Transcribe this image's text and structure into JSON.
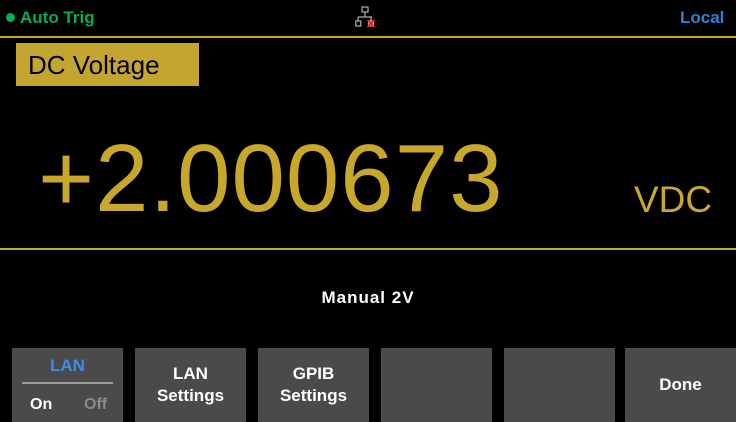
{
  "status_bar": {
    "trigger": "Auto  Trig",
    "remote": "Local",
    "network_icon": "lan-disconnected-icon",
    "indicator_color": "#00b050"
  },
  "measurement": {
    "function": "DC Voltage",
    "value": "+2.000673",
    "unit": "VDC",
    "range": "Manual  2V"
  },
  "softkeys": {
    "lan": {
      "title": "LAN",
      "on": "On",
      "off": "Off",
      "selected": "On"
    },
    "lan_settings": {
      "line1": "LAN",
      "line2": "Settings"
    },
    "gpib_settings": {
      "line1": "GPIB",
      "line2": "Settings"
    },
    "blank_1": "",
    "blank_2": "",
    "done": "Done"
  },
  "colors": {
    "accent": "#c8a82a",
    "softkey_bg": "#4a4a4a",
    "highlight_blue": "#3a8fe8",
    "remote_blue": "#2f7fd8"
  }
}
